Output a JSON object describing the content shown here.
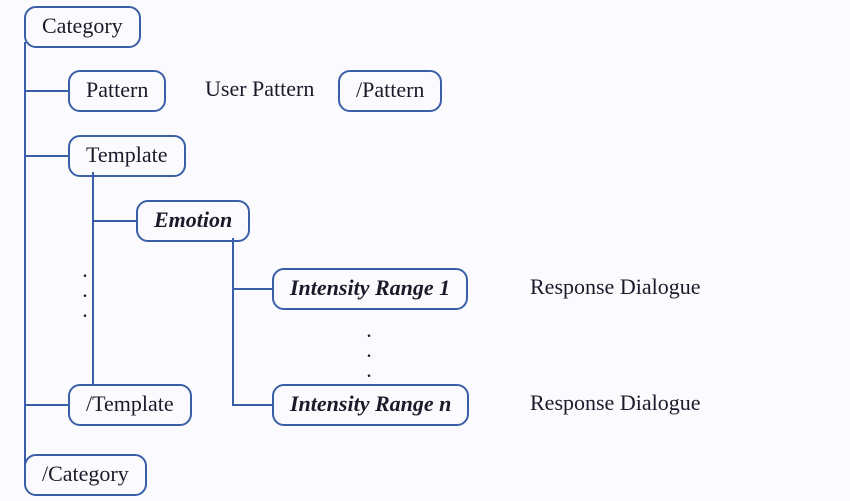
{
  "nodes": {
    "category_open": "Category",
    "pattern_open": "Pattern",
    "pattern_close": "/Pattern",
    "template_open": "Template",
    "template_close": "/Template",
    "emotion": "Emotion",
    "intensity_first": "Intensity Range 1",
    "intensity_last": "Intensity Range n",
    "category_close": "/Category"
  },
  "labels": {
    "user_pattern": "User Pattern",
    "response_first": "Response Dialogue",
    "response_last": "Response Dialogue",
    "ellipsis_v": ".\n.\n.",
    "ellipsis_v2": ".\n.\n."
  }
}
